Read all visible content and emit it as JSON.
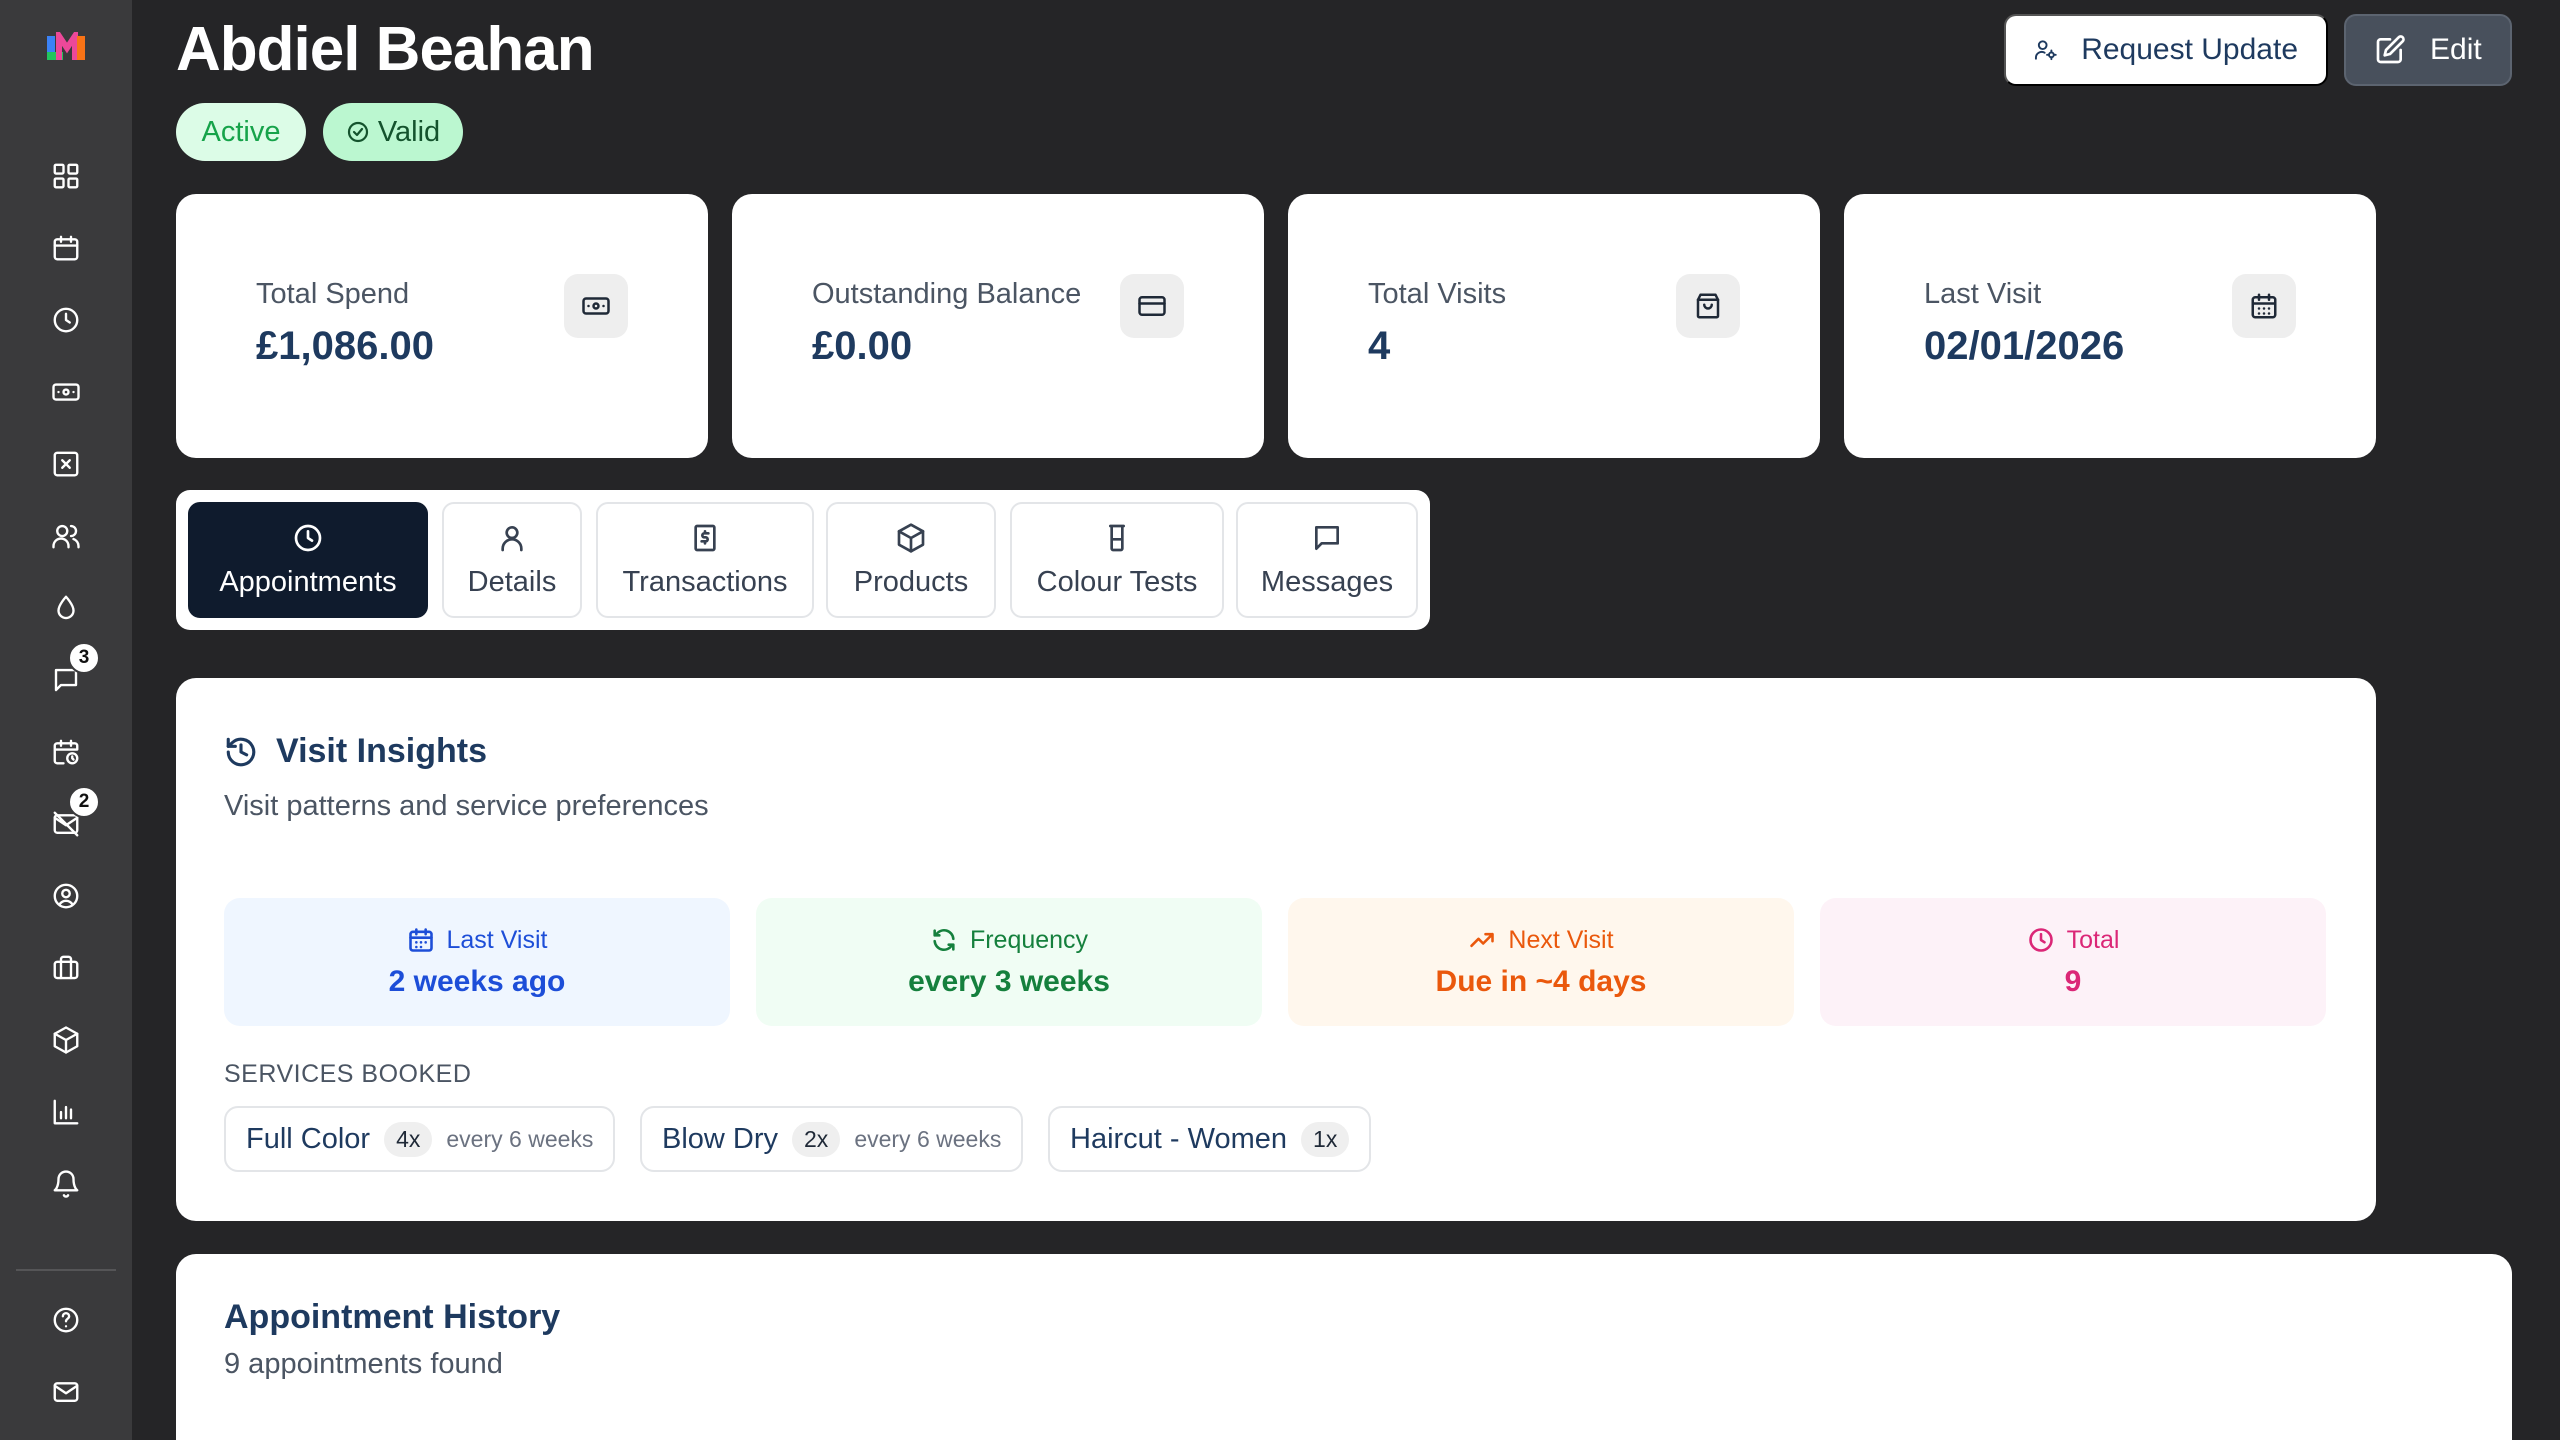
{
  "header": {
    "client_name": "Abdiel Beahan",
    "status_badge": "Active",
    "validity_badge": "Valid",
    "request_update_label": "Request Update",
    "edit_label": "Edit"
  },
  "sidebar": {
    "items": [
      {
        "name": "dashboard",
        "icon": "grid-icon"
      },
      {
        "name": "calendar",
        "icon": "calendar-icon"
      },
      {
        "name": "history",
        "icon": "clock-icon"
      },
      {
        "name": "payments",
        "icon": "banknote-icon"
      },
      {
        "name": "voids",
        "icon": "x-square-icon"
      },
      {
        "name": "clients",
        "icon": "users-icon"
      },
      {
        "name": "colour",
        "icon": "droplet-icon"
      },
      {
        "name": "messages",
        "icon": "message-icon",
        "badge": "3"
      },
      {
        "name": "schedule",
        "icon": "calendar-clock-icon"
      },
      {
        "name": "mail",
        "icon": "mail-off-icon",
        "badge": "2"
      },
      {
        "name": "account",
        "icon": "user-circle-icon"
      },
      {
        "name": "briefcase",
        "icon": "briefcase-icon"
      },
      {
        "name": "products",
        "icon": "package-icon"
      },
      {
        "name": "reports",
        "icon": "bar-chart-icon"
      },
      {
        "name": "notifications",
        "icon": "bell-icon"
      },
      {
        "name": "help",
        "icon": "help-circle-icon"
      },
      {
        "name": "inbox",
        "icon": "envelope-icon"
      }
    ]
  },
  "stats": {
    "total_spend": {
      "label": "Total Spend",
      "value": "£1,086.00"
    },
    "outstanding_balance": {
      "label": "Outstanding Balance",
      "value": "£0.00"
    },
    "total_visits": {
      "label": "Total Visits",
      "value": "4"
    },
    "last_visit": {
      "label": "Last Visit",
      "value": "02/01/2026"
    }
  },
  "tabs": [
    {
      "label": "Appointments",
      "active": true
    },
    {
      "label": "Details"
    },
    {
      "label": "Transactions"
    },
    {
      "label": "Products"
    },
    {
      "label": "Colour Tests"
    },
    {
      "label": "Messages"
    }
  ],
  "insights": {
    "title": "Visit Insights",
    "subtitle": "Visit patterns and service preferences",
    "metrics": [
      {
        "label": "Last Visit",
        "value": "2 weeks ago"
      },
      {
        "label": "Frequency",
        "value": "every 3 weeks"
      },
      {
        "label": "Next Visit",
        "value": "Due in ~4 days"
      },
      {
        "label": "Total",
        "value": "9"
      }
    ],
    "services_label": "SERVICES BOOKED",
    "services": [
      {
        "name": "Full Color",
        "count": "4x",
        "frequency": "every 6 weeks"
      },
      {
        "name": "Blow Dry",
        "count": "2x",
        "frequency": "every 6 weeks"
      },
      {
        "name": "Haircut - Women",
        "count": "1x"
      }
    ]
  },
  "history": {
    "title": "Appointment History",
    "subtitle": "9 appointments found"
  },
  "colors": {
    "background": "#252527",
    "sidebar": "#3a3a3c",
    "active_tab": "#0f1b2d",
    "primary_text": "#1e3a5f"
  }
}
